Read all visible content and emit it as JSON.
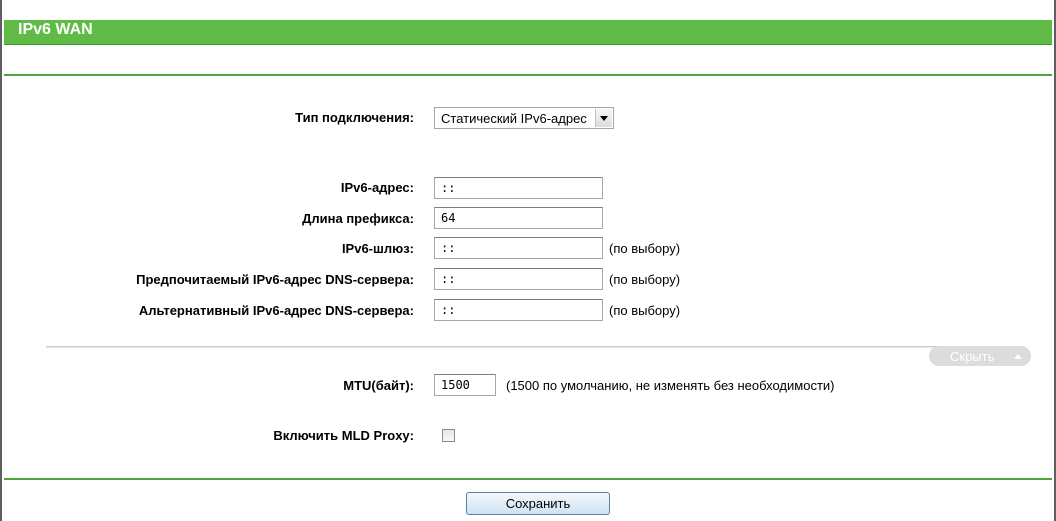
{
  "header": {
    "title": "IPv6 WAN"
  },
  "form": {
    "connection_type": {
      "label": "Тип подключения:",
      "value": "Статический IPv6-адрес"
    },
    "ipv6_address": {
      "label": "IPv6-адрес:",
      "value": "::"
    },
    "prefix_length": {
      "label": "Длина префикса:",
      "value": "64"
    },
    "gateway": {
      "label": "IPv6-шлюз:",
      "value": "::",
      "hint": "(по выбору)"
    },
    "primary_dns": {
      "label": "Предпочитаемый IPv6-адрес DNS-сервера:",
      "value": "::",
      "hint": "(по выбору)"
    },
    "secondary_dns": {
      "label": "Альтернативный IPv6-адрес DNS-сервера:",
      "value": "::",
      "hint": "(по выбору)"
    }
  },
  "advanced": {
    "toggle_label": "Скрыть",
    "toggle_icon": "caret-up-icon",
    "mtu": {
      "label": "MTU(байт):",
      "value": "1500",
      "hint": "(1500 по умолчанию, не изменять без необходимости)"
    },
    "mld_proxy": {
      "label": "Включить MLD Proxy:",
      "checked": false
    }
  },
  "footer": {
    "save_label": "Сохранить"
  },
  "colors": {
    "header_bg": "#5fbb46",
    "divider": "#4ea63a",
    "button_bg": "#cfe2f3"
  }
}
